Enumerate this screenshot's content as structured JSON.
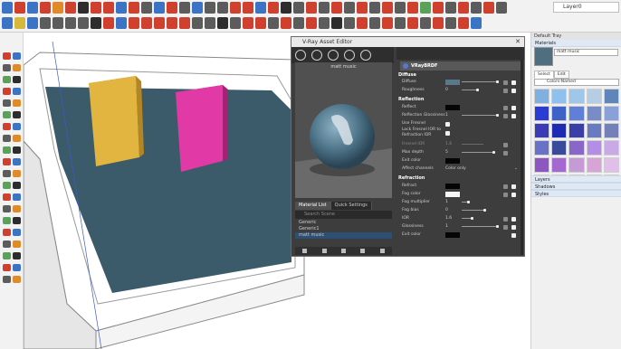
{
  "toolbar": {
    "layer_value": "Layer0"
  },
  "vray_editor": {
    "title": "V-Ray Asset Editor",
    "preview_label": "matt music",
    "tabs": [
      "Material List",
      "Quick Settings"
    ],
    "search_placeholder": "Search Scene",
    "material_list": [
      "Generic",
      "Generic1",
      "matt music"
    ],
    "brdf_label": "VRayBRDF",
    "sections": {
      "diffuse": {
        "title": "Diffuse",
        "rows": [
          {
            "label": "Diffuse",
            "value": ""
          },
          {
            "label": "Roughness",
            "value": "0"
          }
        ]
      },
      "reflection": {
        "title": "Reflection",
        "rows": [
          {
            "label": "Reflect",
            "value": ""
          },
          {
            "label": "Reflection Glossiness",
            "value": "1"
          },
          {
            "label": "Use Fresnel",
            "value": ""
          },
          {
            "label": "Lock Fresnel IOR to Refraction IOR",
            "value": ""
          },
          {
            "label": "Fresnel IOR",
            "value": "1.6"
          },
          {
            "label": "Max depth",
            "value": "5"
          },
          {
            "label": "Exit color",
            "value": ""
          },
          {
            "label": "Affect channels",
            "value": "Color only"
          }
        ]
      },
      "refraction": {
        "title": "Refraction",
        "rows": [
          {
            "label": "Refract",
            "value": ""
          },
          {
            "label": "Fog color",
            "value": ""
          },
          {
            "label": "Fog multiplier",
            "value": "1"
          },
          {
            "label": "Fog bias",
            "value": "0"
          },
          {
            "label": "IOR",
            "value": "1.6"
          },
          {
            "label": "Glossiness",
            "value": "1"
          },
          {
            "label": "Exit color",
            "value": ""
          }
        ]
      }
    }
  },
  "tray": {
    "title": "Default Tray",
    "materials_section": "Materials",
    "material_name": "matt music",
    "tabs": [
      "Select",
      "Edit"
    ],
    "filter_value": "Colors-Named",
    "collapsed_sections": [
      "Layers",
      "Shadows",
      "Styles"
    ],
    "swatches": [
      "#7fb0e0",
      "#8fc0ee",
      "#9ec7ea",
      "#b6cde6",
      "#5e86bb",
      "#2a3bd6",
      "#3e63c8",
      "#5f7fd8",
      "#7a8cc8",
      "#8aa0d8",
      "#3b3bb6",
      "#1d2bb3",
      "#3a3fa8",
      "#6a7ac0",
      "#7480b8",
      "#6a72c8",
      "#3a4a9a",
      "#8a66c8",
      "#b48ee6",
      "#c9a9e6",
      "#8e56c0",
      "#a468d0",
      "#c69ad6",
      "#d8a4d8",
      "#e0c0e8",
      "#7a3fb0",
      "#b080d8",
      "#c090d0",
      "#e2b6e6",
      "#f0d8ee"
    ]
  },
  "colors": {
    "ground": "#3b5a6a",
    "box_yellow": "#e1b53f",
    "box_pink": "#e13aa6",
    "editor_bg": "#3d3d3d"
  }
}
